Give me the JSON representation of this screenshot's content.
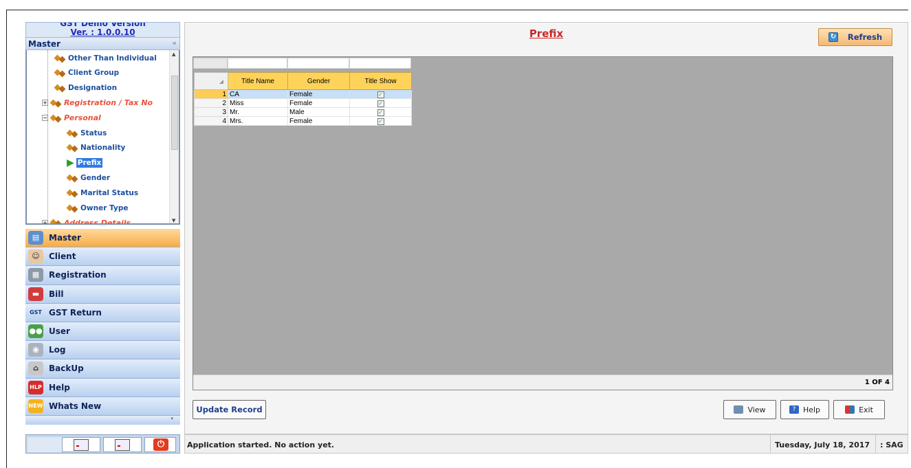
{
  "sidebar": {
    "version_top": "GST Demo Version",
    "version": "Ver. : 1.0.0.10",
    "master_header": "Master",
    "collapse_icon": "chevron-double-left",
    "tree": [
      {
        "label": "Other Than Individual",
        "type": "item"
      },
      {
        "label": "Client Group",
        "type": "item"
      },
      {
        "label": "Designation",
        "type": "item"
      },
      {
        "label": "Registration / Tax No",
        "type": "category",
        "expander": "+"
      },
      {
        "label": "Personal",
        "type": "category",
        "expander": "−"
      },
      {
        "label": "Status",
        "type": "item"
      },
      {
        "label": "Nationality",
        "type": "item"
      },
      {
        "label": "Prefix",
        "type": "selected"
      },
      {
        "label": "Gender",
        "type": "item"
      },
      {
        "label": "Marital Status",
        "type": "item"
      },
      {
        "label": "Owner Type",
        "type": "item"
      },
      {
        "label": "Address Details",
        "type": "category",
        "expander": "+"
      }
    ],
    "nav": [
      {
        "label": "Master",
        "icon": "master-icon",
        "active": true
      },
      {
        "label": "Client",
        "icon": "client-icon"
      },
      {
        "label": "Registration",
        "icon": "registration-icon"
      },
      {
        "label": "Bill",
        "icon": "bill-icon"
      },
      {
        "label": "GST Return",
        "icon": "gst-icon"
      },
      {
        "label": "User",
        "icon": "user-icon"
      },
      {
        "label": "Log",
        "icon": "log-icon"
      },
      {
        "label": "BackUp",
        "icon": "backup-icon"
      },
      {
        "label": "Help",
        "icon": "help-icon"
      },
      {
        "label": "Whats New",
        "icon": "new-icon"
      }
    ]
  },
  "main": {
    "title": "Prefix",
    "refresh_label": "Refresh",
    "grid": {
      "columns": [
        "Title Name",
        "Gender",
        "Title Show"
      ],
      "rows": [
        {
          "n": "1",
          "title": "CA",
          "gender": "Female",
          "show": true
        },
        {
          "n": "2",
          "title": "Miss",
          "gender": "Female",
          "show": true
        },
        {
          "n": "3",
          "title": "Mr.",
          "gender": "Male",
          "show": true
        },
        {
          "n": "4",
          "title": "Mrs.",
          "gender": "Female",
          "show": true
        }
      ],
      "pager": "1 OF 4"
    },
    "update_label": "Update Record",
    "view_label": "View",
    "help_label": "Help",
    "exit_label": "Exit"
  },
  "status": {
    "message": "Application started. No action yet.",
    "date": "Tuesday, July 18, 2017",
    "user": ": SAG"
  },
  "colors": {
    "accent_orange": "#f7ac45",
    "title_red": "#c62a2a",
    "link_blue": "#1d3d8f",
    "header_yellow": "#ffd35a"
  }
}
